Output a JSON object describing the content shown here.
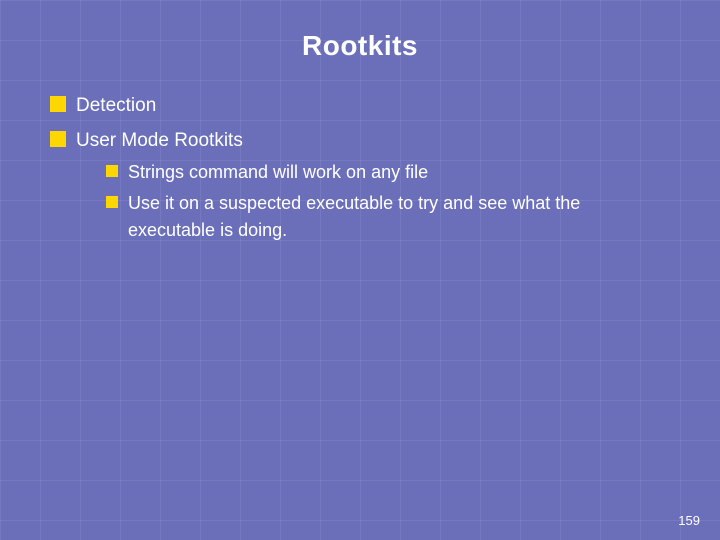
{
  "slide": {
    "title": "Rootkits",
    "bullets": [
      {
        "id": "detection",
        "text": "Detection",
        "sub_bullets": []
      },
      {
        "id": "user-mode-rootkits",
        "text": "User Mode Rootkits",
        "sub_bullets": [
          {
            "id": "strings-command",
            "text": "Strings command will work on any file"
          },
          {
            "id": "use-it",
            "text": "Use it on a suspected executable to try and see what the executable is doing."
          }
        ]
      }
    ],
    "page_number": "159"
  }
}
